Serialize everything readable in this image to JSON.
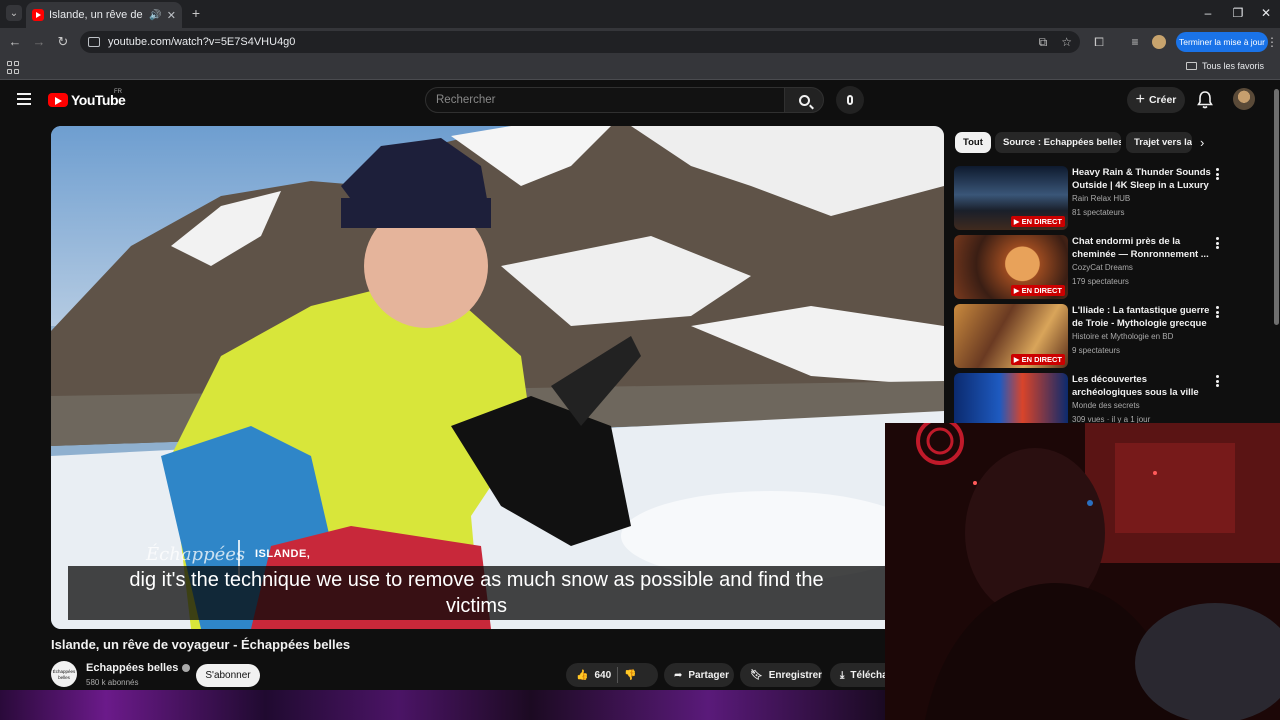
{
  "browser": {
    "tab_title": "Islande, un rêve de voyageur",
    "url": "youtube.com/watch?v=5E7S4VHU4g0",
    "update_button": "Terminer la mise à jour",
    "bookmarks_label": "Tous les favoris"
  },
  "youtube": {
    "logo_text": "YouTube",
    "country": "FR",
    "search_placeholder": "Rechercher",
    "create_label": "Créer"
  },
  "video": {
    "subtitle_line1": "dig it's the technique we use to remove as much snow as possible and find the",
    "subtitle_line2": "victims",
    "watermark_brand": "Échappées",
    "watermark_title": "ISLANDE,",
    "title": "Islande, un rêve de voyageur - Échappées belles",
    "channel_name": "Echappées belles",
    "channel_avatar_text": "Échappées belles",
    "subscribers": "580 k abonnés",
    "subscribe_label": "S'abonner",
    "likes": "640",
    "share_label": "Partager",
    "save_label": "Enregistrer",
    "download_label": "Téléchar"
  },
  "sidebar": {
    "chips": [
      "Tout",
      "Source : Echappées belles",
      "Trajet vers la"
    ],
    "recommendations": [
      {
        "title": "Heavy Rain & Thunder Sounds Outside | 4K Sleep in a Luxury ...",
        "channel": "Rain Relax HUB",
        "meta": "81 spectateurs",
        "badge": "EN DIRECT"
      },
      {
        "title": "Chat endormi près de la cheminée — Ronronnement ...",
        "channel": "CozyCat Dreams",
        "meta": "179 spectateurs",
        "badge": "EN DIRECT"
      },
      {
        "title": "L'Iliade : La fantastique guerre de Troie - Mythologie grecque",
        "channel": "Histoire et Mythologie en BD",
        "meta": "9 spectateurs",
        "badge": "EN DIRECT"
      },
      {
        "title": "Les découvertes archéologiques sous la ville de...",
        "channel": "Monde des secrets",
        "meta": "309 vues · il y a 1 jour",
        "badge": ""
      }
    ]
  },
  "colors": {
    "yt_red": "#ff0000",
    "live_red": "#cc0000",
    "update_blue": "#1a73e8",
    "page_bg": "#0f0f0f"
  }
}
